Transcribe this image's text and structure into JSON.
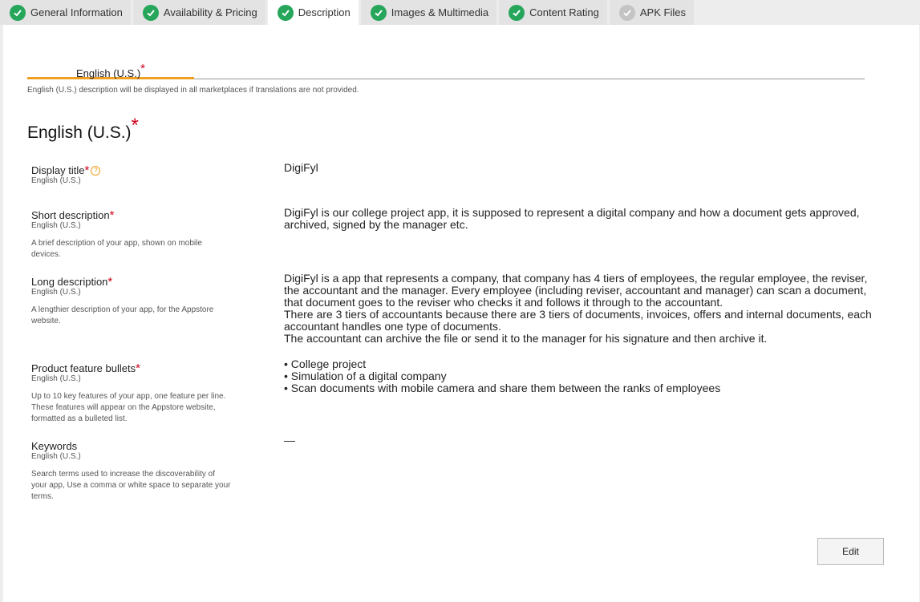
{
  "tabs": [
    {
      "label": "General Information",
      "status": "complete"
    },
    {
      "label": "Availability & Pricing",
      "status": "complete"
    },
    {
      "label": "Description",
      "status": "complete"
    },
    {
      "label": "Images & Multimedia",
      "status": "complete"
    },
    {
      "label": "Content Rating",
      "status": "complete"
    },
    {
      "label": "APK Files",
      "status": "incomplete"
    }
  ],
  "language_tab": {
    "label": "English (U.S.)",
    "required_mark": "*"
  },
  "notice": "English (U.S.) description will be displayed in all marketplaces if translations are not provided.",
  "section_title": "English (U.S.)",
  "required_mark": "*",
  "fields": {
    "display_title": {
      "label": "Display title",
      "sub": "English (U.S.)",
      "help_icon": "?",
      "value": "DigiFyl"
    },
    "short_description": {
      "label": "Short description",
      "sub": "English (U.S.)",
      "desc": "A brief description of your app, shown on mobile devices.",
      "value": "DigiFyl is our college project app, it is supposed to represent a digital company and how a document gets approved, archived, signed by the manager etc."
    },
    "long_description": {
      "label": "Long description",
      "sub": "English (U.S.)",
      "desc": "A lengthier description of your app, for the Appstore website.",
      "value": "DigiFyl is a app that represents a company, that company has 4 tiers of employees, the regular employee, the reviser, the accountant and the manager. Every employee (including reviser, accountant and manager) can scan a document, that document goes to the reviser who checks it and follows it through to the accountant.\nThere are 3 tiers of accountants because there are 3 tiers of documents, invoices, offers and internal documents, each accountant handles one type of documents.\nThe accountant can archive the file or send it to the manager for his signature and then archive it."
    },
    "feature_bullets": {
      "label": "Product feature bullets",
      "sub": "English (U.S.)",
      "desc": "Up to 10 key features of your app, one feature per line. These features will appear on the Appstore website, formatted as a bulleted list.",
      "value": "• College project\n• Simulation of a digital company\n• Scan documents with mobile camera and share them between the ranks of employees"
    },
    "keywords": {
      "label": "Keywords",
      "sub": "English (U.S.)",
      "desc": "Search terms used to increase the discoverability of your app, Use a comma or white space to separate your terms.",
      "value": "—"
    }
  },
  "edit_button": "Edit",
  "colors": {
    "accent": "#f0a020",
    "check_green": "#26a65b",
    "check_gray": "#c4c4c4",
    "required": "#d0021b"
  }
}
